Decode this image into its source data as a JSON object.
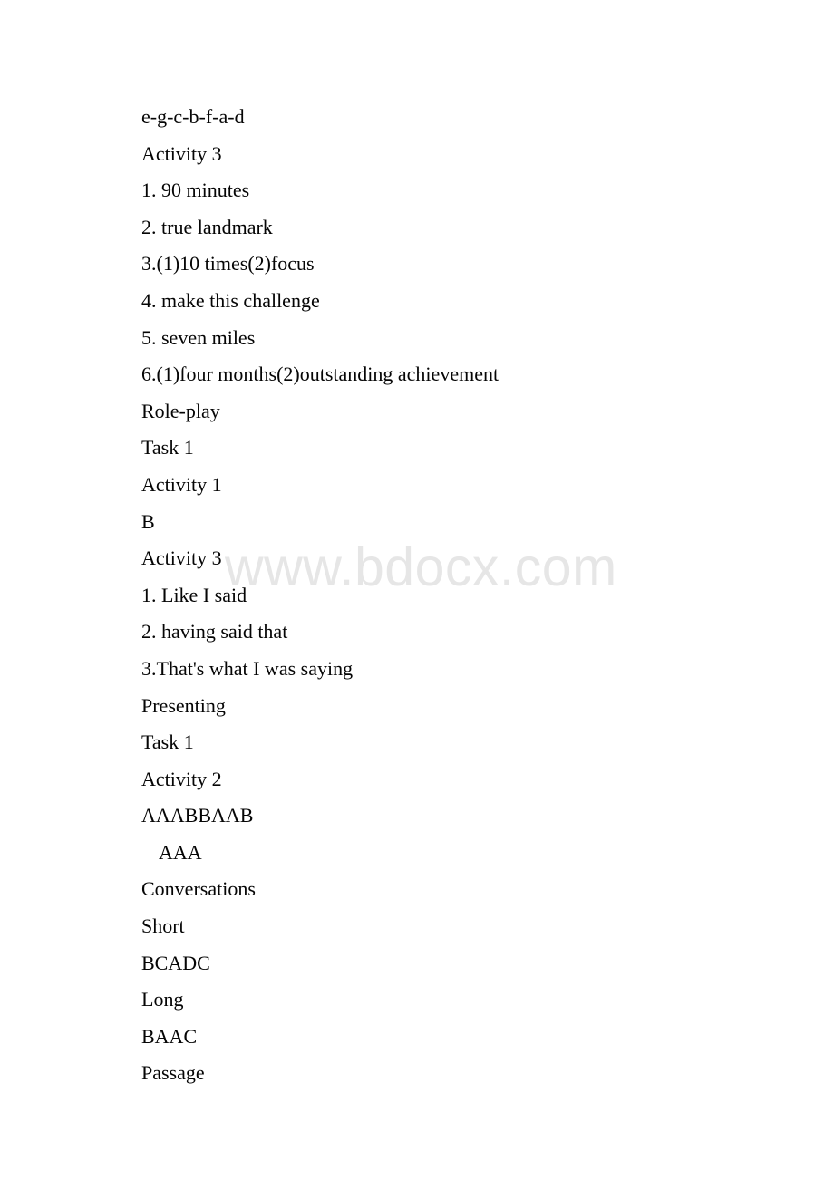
{
  "page": {
    "background_color": "#ffffff",
    "text_color": "#050505"
  },
  "watermark": {
    "text": "www.bdocx.com",
    "color": "#e6e6e6"
  },
  "document": {
    "lines": [
      {
        "text": "e-g-c-b-f-a-d",
        "indent": false
      },
      {
        "text": "Activity 3",
        "indent": false
      },
      {
        "text": "1. 90 minutes",
        "indent": false
      },
      {
        "text": "2. true landmark",
        "indent": false
      },
      {
        "text": "3.(1)10 times(2)focus",
        "indent": false
      },
      {
        "text": "4. make this challenge",
        "indent": false
      },
      {
        "text": "5. seven miles",
        "indent": false
      },
      {
        "text": "6.(1)four months(2)outstanding achievement",
        "indent": false
      },
      {
        "text": "Role-play",
        "indent": false
      },
      {
        "text": "Task 1",
        "indent": false
      },
      {
        "text": "Activity 1",
        "indent": false
      },
      {
        "text": "B",
        "indent": false
      },
      {
        "text": "Activity 3",
        "indent": false
      },
      {
        "text": "1. Like I said",
        "indent": false
      },
      {
        "text": "2. having said that",
        "indent": false
      },
      {
        "text": "3.That's what I was saying",
        "indent": false
      },
      {
        "text": "Presenting",
        "indent": false
      },
      {
        "text": "Task 1",
        "indent": false
      },
      {
        "text": "Activity 2",
        "indent": false
      },
      {
        "text": "AAABBAAB",
        "indent": false
      },
      {
        "text": "AAA",
        "indent": true
      },
      {
        "text": "Conversations",
        "indent": false
      },
      {
        "text": "Short",
        "indent": false
      },
      {
        "text": "BCADC",
        "indent": false
      },
      {
        "text": "Long",
        "indent": false
      },
      {
        "text": "BAAC",
        "indent": false
      },
      {
        "text": "Passage",
        "indent": false
      }
    ]
  }
}
